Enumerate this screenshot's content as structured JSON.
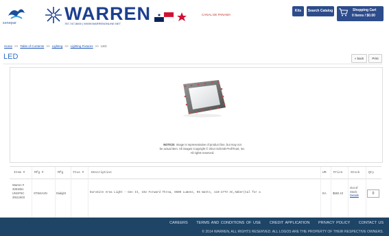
{
  "header": {
    "sonepar_text": "sonepar",
    "warren_word": "WARREN",
    "warren_sub": "787-747-8600 | WWW.WARRENONLINE.NET",
    "flag_text": "CANAL DE PANAMA",
    "btn_kits": "Kits",
    "btn_search_catalog": "Search Catalog",
    "cart_label": "Shopping Cart",
    "cart_items": "0 Items / $0.00"
  },
  "breadcrumb": {
    "home": "Home",
    "toc": "Table of Contents",
    "lighting": "Lighting",
    "fixtures": "Lighting Fixtures",
    "current": "LED",
    "sep": ">>"
  },
  "page": {
    "title": "LED",
    "back": "« back",
    "print": "Print"
  },
  "notice": {
    "bold": "NOTICE:",
    "line1": " Image is representative of product line, but may not",
    "line2": "be actual item. All images Copyright © 2014 Schmitt ProfiTrust, Inc.",
    "line3": "All rights reserved."
  },
  "table": {
    "headers": [
      "Item #",
      "Mfg #",
      "Mfg",
      "Ytus #",
      "Description",
      "UM",
      "Price",
      "Stock",
      "Qty"
    ],
    "row": {
      "item": "Warren # 3081851",
      "unspsc": "UNSPSC 39111603",
      "mfg_no": "STW4A2N",
      "mfg": "Dialight",
      "description": "DuroSite Area Light - Gen II, 192 Forward Throw, 9500 Lumens, 95 Watts, 110-277V AC,Amber(Cal for a",
      "um": "EA",
      "price": "$582.10",
      "stock_line1": "Out of",
      "stock_line2": "Stock",
      "stock_link": "Details",
      "qty": "0"
    }
  },
  "footer": {
    "links": [
      "CAREERS",
      "TERMS AND CONDITIONS OF USE",
      "CREDIT APPLICATION",
      "PRIVACY POLICY",
      "CONTACT US"
    ],
    "copyright": "© 2014 WARREN, ALL RIGHTS RESERVED. ALL LOGOS ARE THE PROPERTY OF THEIR RESPECTIVE OWNERS."
  },
  "colors": {
    "brand_blue": "#1d3f8f",
    "button_blue": "#2d4c8c",
    "title_blue": "#2b6dc4",
    "footer_bg": "#1e4466"
  }
}
